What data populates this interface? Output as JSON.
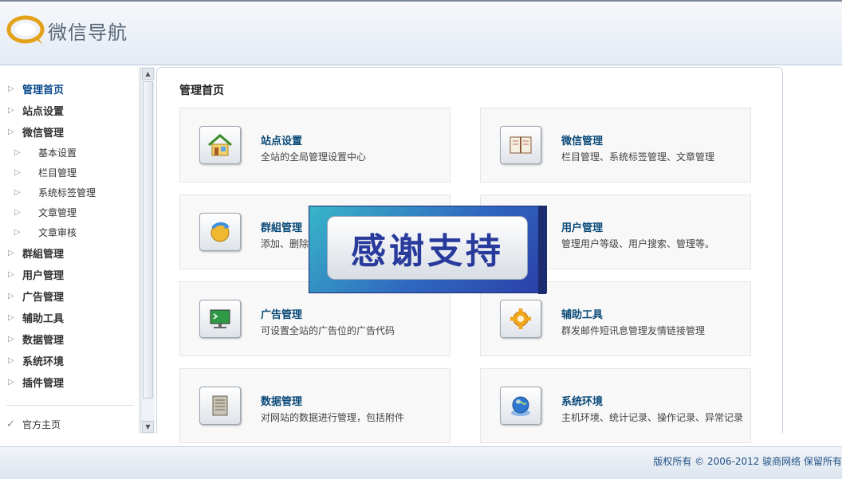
{
  "header": {
    "logo_text": "微信导航"
  },
  "sidebar": {
    "items": [
      {
        "label": "管理首页",
        "active": true
      },
      {
        "label": "站点设置"
      },
      {
        "label": "微信管理"
      }
    ],
    "sub_items": [
      {
        "label": "基本设置"
      },
      {
        "label": "栏目管理"
      },
      {
        "label": "系统标签管理"
      },
      {
        "label": "文章管理"
      },
      {
        "label": "文章审核"
      }
    ],
    "items_after": [
      {
        "label": "群組管理"
      },
      {
        "label": "用户管理"
      },
      {
        "label": "广告管理"
      },
      {
        "label": "辅助工具"
      },
      {
        "label": "数据管理"
      },
      {
        "label": "系统环境"
      },
      {
        "label": "插件管理"
      }
    ],
    "home_link": "官方主页"
  },
  "main": {
    "title": "管理首页",
    "cards": [
      {
        "title": "站点设置",
        "desc": "全站的全局管理设置中心",
        "icon": "house-icon"
      },
      {
        "title": "微信管理",
        "desc": "栏目管理、系统标签管理、文章管理",
        "icon": "notebook-icon"
      },
      {
        "title": "群組管理",
        "desc": "添加、删除",
        "icon": "group-refresh-icon"
      },
      {
        "title": "用户管理",
        "desc": "管理用户等级、用户搜索、管理等。",
        "icon": "user-icon"
      },
      {
        "title": "广告管理",
        "desc": "可设置全站的广告位的广告代码",
        "icon": "monitor-icon"
      },
      {
        "title": "辅助工具",
        "desc": "群发邮件短讯息管理友情链接管理",
        "icon": "gear-icon"
      },
      {
        "title": "数据管理",
        "desc": "对网站的数据进行管理，包括附件",
        "icon": "database-book-icon"
      },
      {
        "title": "系统环境",
        "desc": "主机环境、统计记录、操作记录、异常记录",
        "icon": "globe-icon"
      }
    ]
  },
  "banner": {
    "text": "感谢支持"
  },
  "footer": {
    "text": "版权所有 © 2006-2012 骏商网络 保留所有"
  },
  "colors": {
    "accent": "#0b4a78",
    "banner": "#2a3ea8"
  }
}
